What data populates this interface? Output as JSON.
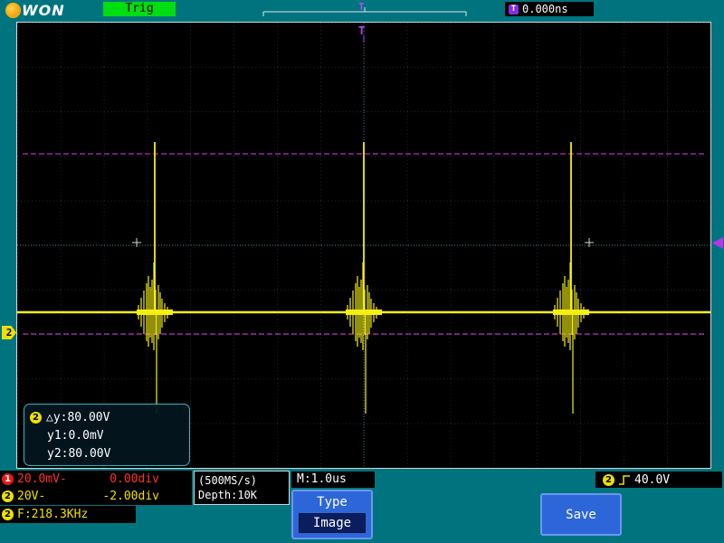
{
  "topbar": {
    "brand_text": "WON",
    "trig_label": "Trig",
    "trigger_marker": "T",
    "t_badge": "T",
    "trigger_time": "0.000ns"
  },
  "grid": {
    "top_marker": "T",
    "channel2_marker": "2"
  },
  "cursor_info": {
    "badge": "2",
    "dy": "△y:80.00V",
    "y1": "y1:0.0mV",
    "y2": "y2:80.00V"
  },
  "status": {
    "ch1_badge": "1",
    "ch1_scale": "20.0mV-",
    "ch1_offset": "0.00div",
    "ch2_badge": "2",
    "ch2_scale": "20V-",
    "ch2_offset": "-2.00div",
    "freq_badge": "2",
    "freq": "F:218.3KHz",
    "sample_rate": "(500MS/s)",
    "depth": "Depth:10K",
    "timebase": "M:1.0us",
    "trig_badge": "2",
    "trig_level": "40.0V"
  },
  "menu": {
    "type_label": "Type",
    "type_value": "Image",
    "save_label": "Save"
  }
}
